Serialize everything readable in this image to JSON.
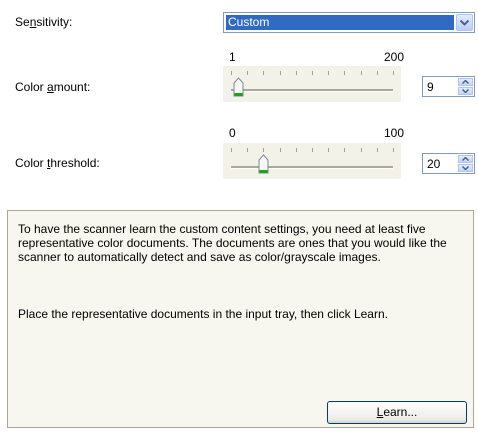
{
  "sensitivity": {
    "label_pre": "Se",
    "label_ul": "n",
    "label_post": "sitivity:",
    "selected": "Custom",
    "arrow_icon": "chevron-down-icon"
  },
  "color_amount": {
    "label_pre": "Color ",
    "label_ul": "a",
    "label_post": "mount:",
    "range_min": "1",
    "range_max": "200",
    "value": "9",
    "value_num": 9,
    "min": 1,
    "max": 200
  },
  "color_threshold": {
    "label_pre": "Color ",
    "label_ul": "t",
    "label_post": "hreshold:",
    "range_min": "0",
    "range_max": "100",
    "value": "20",
    "value_num": 20,
    "min": 0,
    "max": 100
  },
  "info": {
    "paragraph1": "To have the scanner learn the custom content settings, you need at least five representative color documents. The documents are ones that you would like the scanner to automatically detect and save as color/grayscale images.",
    "paragraph2": "Place the representative documents in the input tray, then click Learn."
  },
  "learn_button": {
    "label_ul": "L",
    "label_post": "earn..."
  },
  "colors": {
    "selection": "#316ac5",
    "thumb_accent": "#21a121",
    "border": "#7f9db9"
  }
}
